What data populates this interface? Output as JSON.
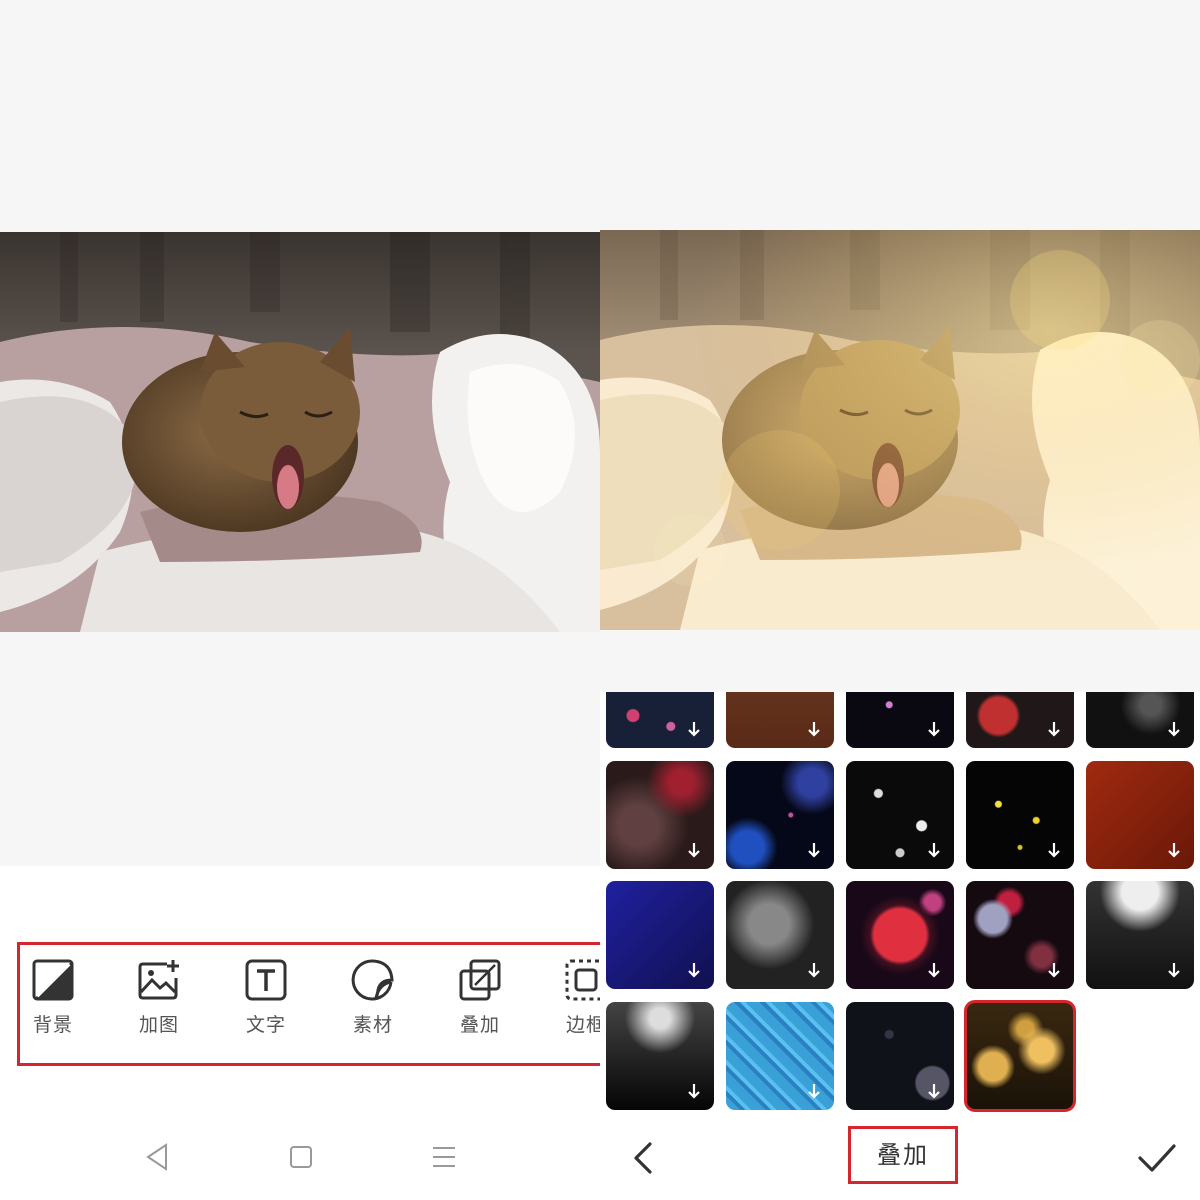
{
  "left_panel": {
    "tools": [
      {
        "label": "背景",
        "icon": "background-icon"
      },
      {
        "label": "加图",
        "icon": "add-image-icon"
      },
      {
        "label": "文字",
        "icon": "text-icon"
      },
      {
        "label": "素材",
        "icon": "sticker-icon"
      },
      {
        "label": "叠加",
        "icon": "overlay-icon"
      },
      {
        "label": "边框",
        "icon": "frame-icon"
      }
    ],
    "system_nav": [
      "back-triangle-icon",
      "home-square-icon",
      "menu-lines-icon"
    ]
  },
  "right_panel": {
    "title": "叠加",
    "overlay_thumbnails": [
      {
        "name": "overlay-bokeh-pink",
        "row": 0
      },
      {
        "name": "overlay-brown",
        "row": 0
      },
      {
        "name": "overlay-dark-sparkle",
        "row": 0
      },
      {
        "name": "overlay-red-text",
        "row": 0
      },
      {
        "name": "overlay-dust-dark",
        "row": 0
      },
      {
        "name": "overlay-red-smoke",
        "row": 1
      },
      {
        "name": "overlay-galaxy-stars",
        "row": 1
      },
      {
        "name": "overlay-white-petals",
        "row": 1
      },
      {
        "name": "overlay-gold-dots",
        "row": 1
      },
      {
        "name": "overlay-rust-frame",
        "row": 1
      },
      {
        "name": "overlay-blue-frame",
        "row": 2
      },
      {
        "name": "overlay-grey-smoke",
        "row": 2
      },
      {
        "name": "overlay-red-sphere",
        "row": 2
      },
      {
        "name": "overlay-red-bokeh",
        "row": 2
      },
      {
        "name": "overlay-light-leak-bw",
        "row": 2
      },
      {
        "name": "overlay-spotlight",
        "row": 3
      },
      {
        "name": "overlay-water-caustics",
        "row": 3
      },
      {
        "name": "overlay-dark-bubbles",
        "row": 3
      },
      {
        "name": "overlay-golden-bokeh",
        "row": 3,
        "selected": true
      }
    ],
    "icons": {
      "back": "chevron-left-icon",
      "confirm": "checkmark-icon"
    }
  },
  "colors": {
    "highlight": "#d6262d",
    "canvas_bg": "#f6f6f6",
    "tool_label": "#555555"
  }
}
